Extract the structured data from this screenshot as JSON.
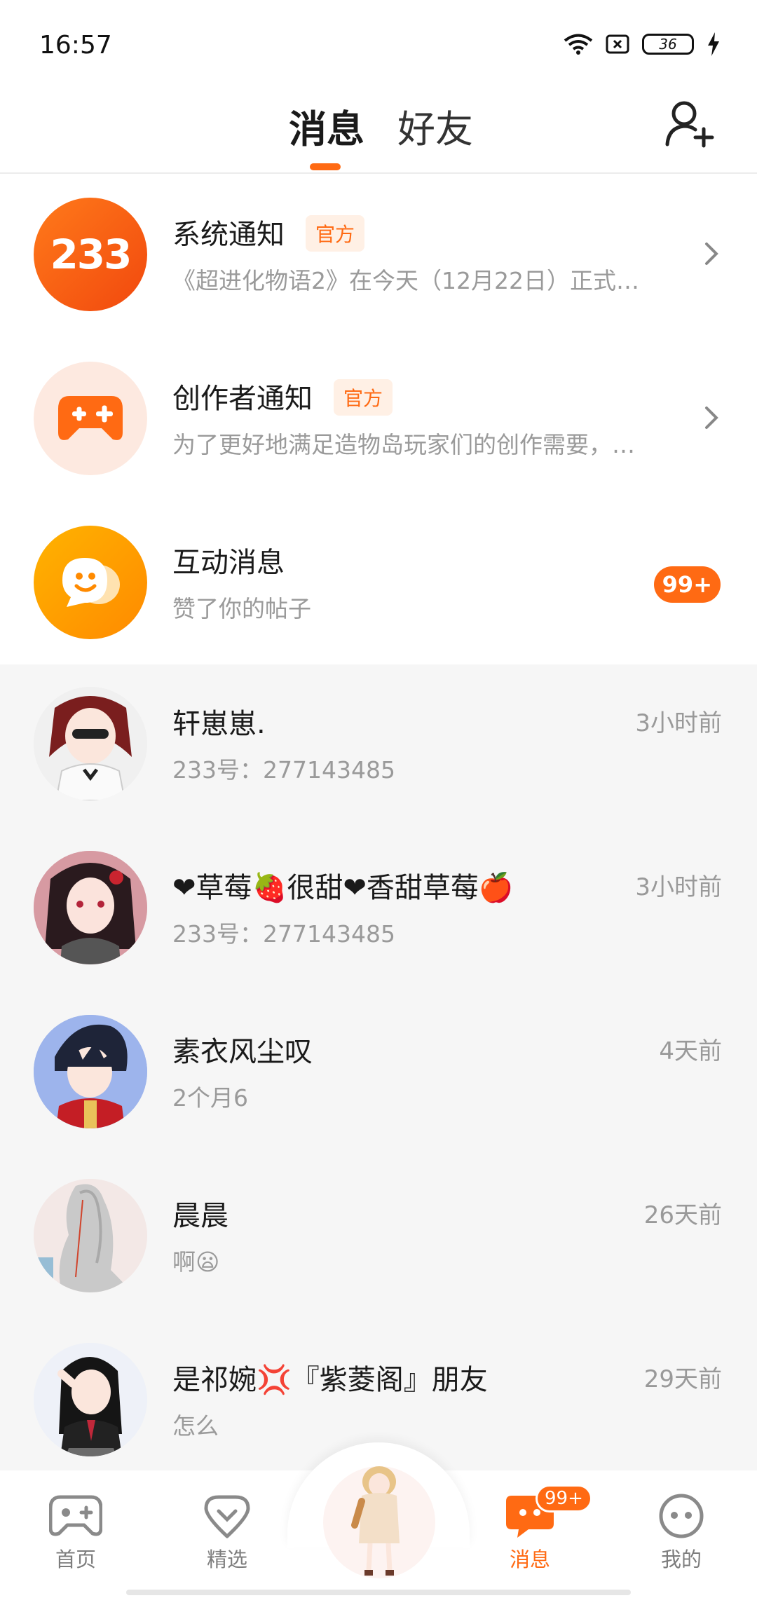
{
  "status_bar": {
    "time": "16:57",
    "battery": "36"
  },
  "header": {
    "tab_messages": "消息",
    "tab_friends": "好友"
  },
  "official": [
    {
      "title": "系统通知",
      "badge": "官方",
      "subtitle": "《超进化物语2》在今天（12月22日）正式…",
      "avatar_text": "233"
    },
    {
      "title": "创作者通知",
      "badge": "官方",
      "subtitle": "为了更好地满足造物岛玩家们的创作需要，…"
    },
    {
      "title": "互动消息",
      "subtitle": "赞了你的帖子",
      "count": "99+"
    }
  ],
  "chats": [
    {
      "name": "轩崽崽.",
      "preview": "233号：277143485",
      "time": "3小时前"
    },
    {
      "name": "❤草莓🍓很甜❤香甜草莓🍎",
      "preview": "233号：277143485",
      "time": "3小时前"
    },
    {
      "name": "素衣风尘叹",
      "preview": "2个月6",
      "time": "4天前"
    },
    {
      "name": "晨晨",
      "preview": "啊😦",
      "time": "26天前"
    },
    {
      "name": "是祁婉💢『紫菱阁』朋友",
      "preview": "怎么",
      "time": "29天前"
    }
  ],
  "nav": {
    "home": "首页",
    "featured": "精选",
    "messages": "消息",
    "messages_badge": "99+",
    "mine": "我的"
  },
  "colors": {
    "accent": "#ff6a13",
    "chat_bg": "#f6f6f6"
  }
}
